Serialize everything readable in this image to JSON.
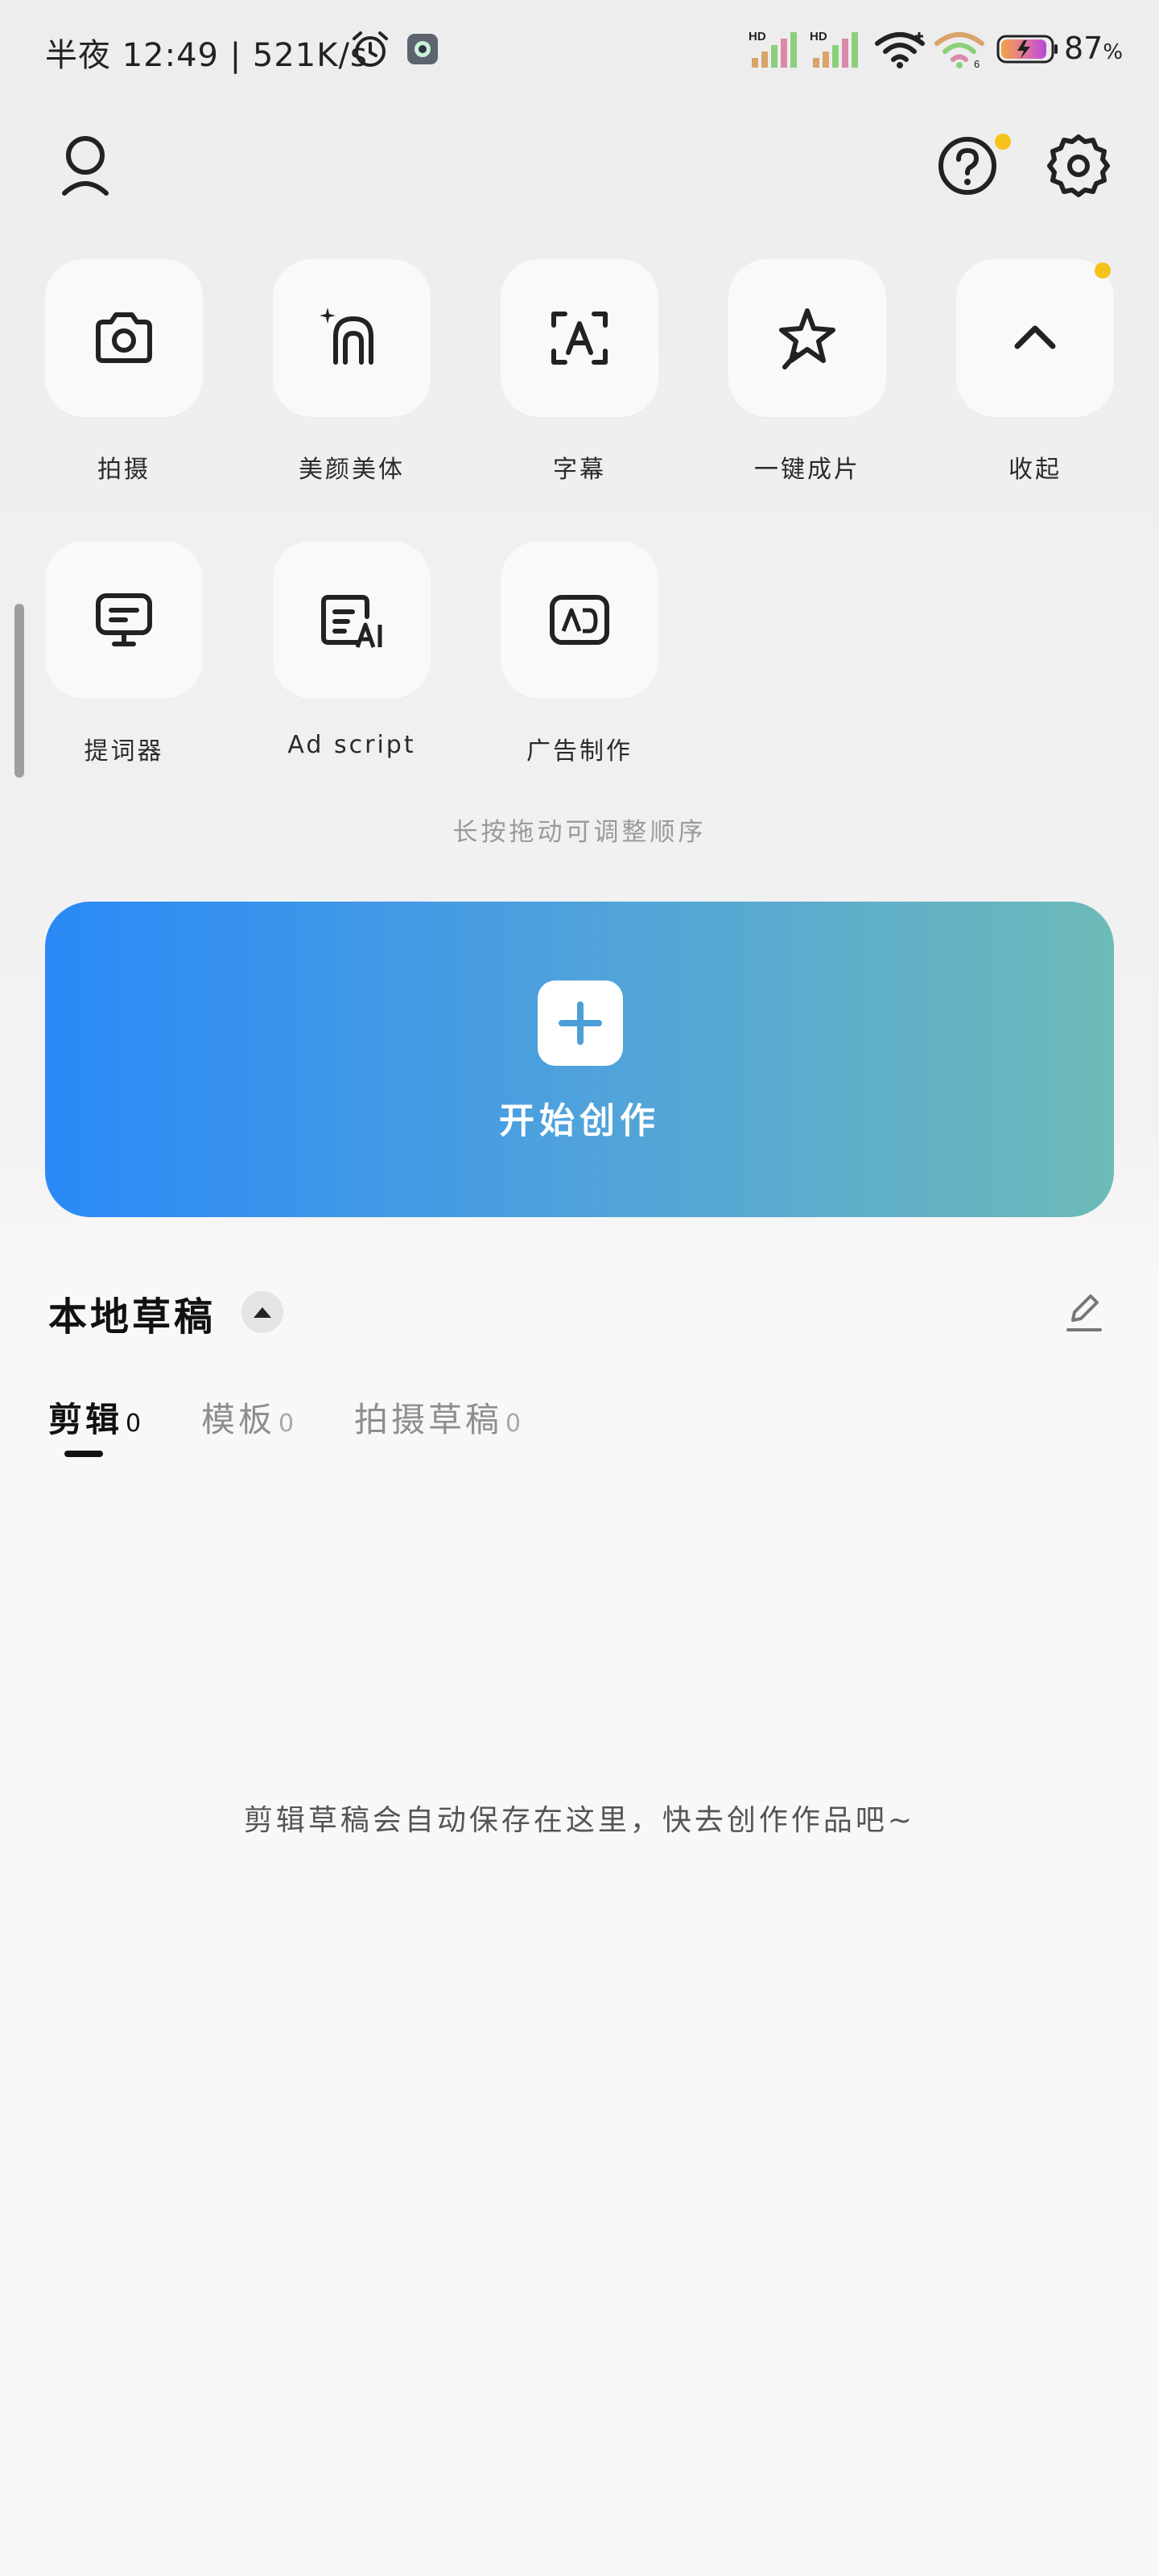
{
  "status_bar": {
    "time": "半夜 12:49 | 521K/s",
    "battery_percent": "87",
    "battery_unit": "%",
    "battery_level": 0.87,
    "icons": [
      "alarm-icon",
      "app-notification-icon",
      "hd-signal-icon",
      "hd-signal-icon",
      "wifi-icon",
      "wifi-6-icon",
      "battery-charging-icon"
    ]
  },
  "header": {
    "icons": [
      "profile-icon",
      "help-icon",
      "settings-icon"
    ],
    "accent_dot_color": "#f6c21b"
  },
  "tools": [
    {
      "label": "拍摄",
      "icon": "camera-icon"
    },
    {
      "label": "美颜美体",
      "icon": "beauty-icon"
    },
    {
      "label": "字幕",
      "icon": "subtitle-icon"
    },
    {
      "label": "一键成片",
      "icon": "magic-star-icon"
    },
    {
      "label": "收起",
      "icon": "chevron-up-icon"
    },
    {
      "label": "提词器",
      "icon": "teleprompter-icon"
    },
    {
      "label": "Ad script",
      "icon": "ai-script-icon"
    },
    {
      "label": "广告制作",
      "icon": "ad-maker-icon"
    }
  ],
  "hint": "长按拖动可调整顺序",
  "create": {
    "label": "开始创作",
    "gradient_start": "#2a89f7",
    "gradient_end": "#6dbab9"
  },
  "drafts": {
    "title": "本地草稿",
    "tabs": [
      {
        "label": "剪辑",
        "count": "0"
      },
      {
        "label": "模板",
        "count": "0"
      },
      {
        "label": "拍摄草稿",
        "count": "0"
      }
    ],
    "empty_message": "剪辑草稿会自动保存在这里，快去创作作品吧~"
  }
}
